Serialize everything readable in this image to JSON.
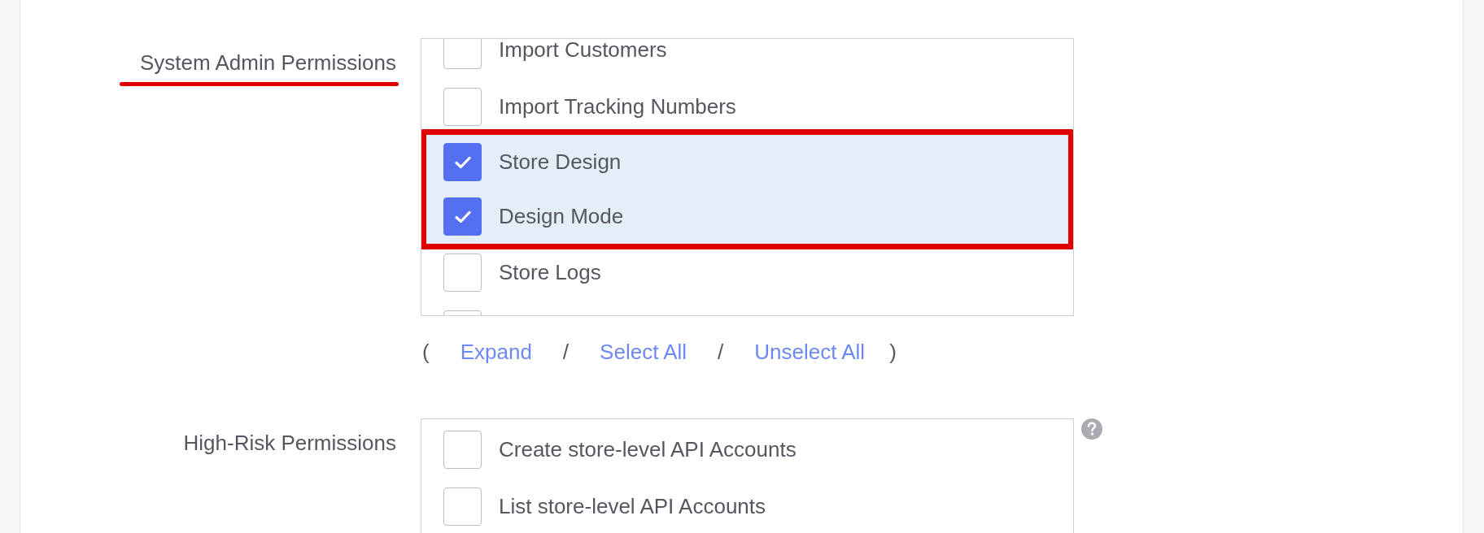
{
  "sections": [
    {
      "label": "System Admin Permissions",
      "underlined": true,
      "help": false,
      "items": [
        {
          "label": "Import Customers",
          "checked": false,
          "highlighted": false
        },
        {
          "label": "Import Tracking Numbers",
          "checked": false,
          "highlighted": false
        },
        {
          "label": "Store Design",
          "checked": true,
          "highlighted": true
        },
        {
          "label": "Design Mode",
          "checked": true,
          "highlighted": true
        },
        {
          "label": "Store Logs",
          "checked": false,
          "highlighted": false
        },
        {
          "checked": false,
          "highlighted": false
        }
      ],
      "links": {
        "open": "(",
        "close": ")",
        "separator": "/",
        "items": [
          "Expand",
          "Select All",
          "Unselect All"
        ]
      }
    },
    {
      "label": "High-Risk Permissions",
      "underlined": false,
      "help": true,
      "items": [
        {
          "label": "Create store-level API Accounts",
          "checked": false,
          "highlighted": false
        },
        {
          "label": "List store-level API Accounts",
          "checked": false,
          "highlighted": false
        }
      ]
    }
  ]
}
